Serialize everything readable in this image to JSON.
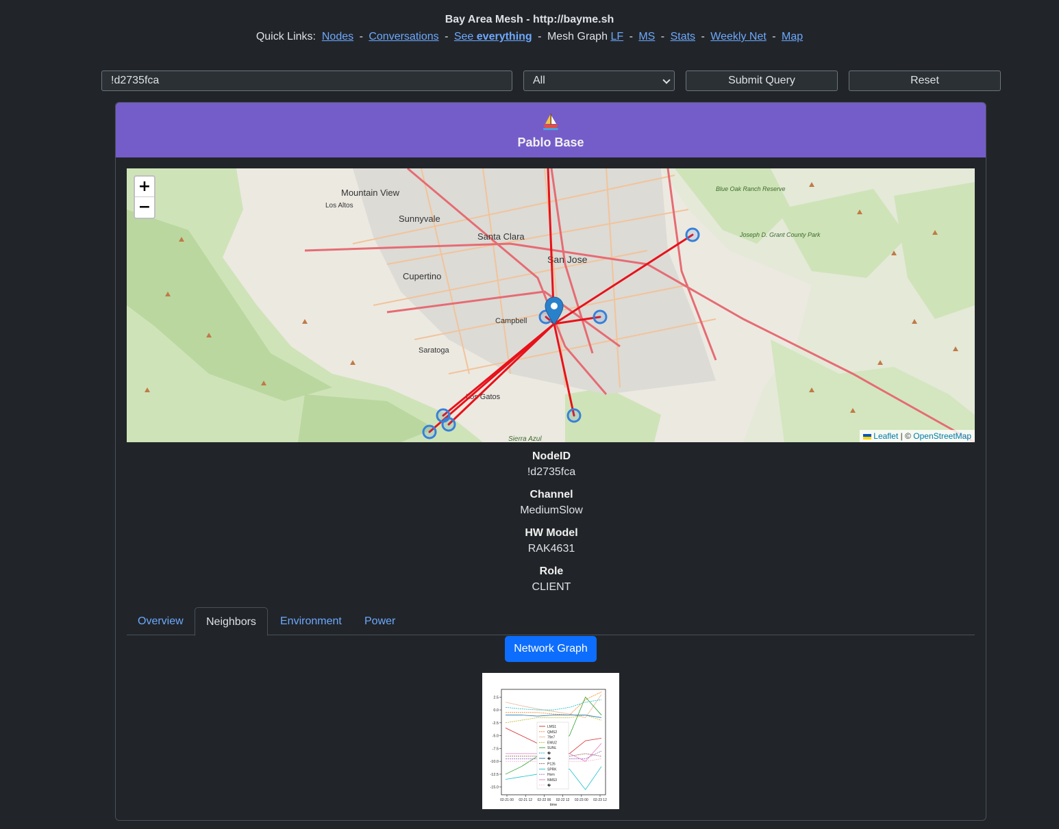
{
  "header": {
    "title": "Bay Area Mesh - http://bayme.sh",
    "quick_links_label": "Quick Links:",
    "links": {
      "nodes": "Nodes",
      "conversations": "Conversations",
      "see": "See ",
      "everything": "everything",
      "mesh_graph": "Mesh Graph",
      "lf": "LF",
      "ms": "MS",
      "stats": "Stats",
      "weekly_net": "Weekly Net",
      "map": "Map"
    },
    "sep": "-"
  },
  "query": {
    "node_value": "!d2735fca",
    "filter_selected": "All",
    "submit_label": "Submit Query",
    "reset_label": "Reset"
  },
  "node": {
    "icon": "sailboat-icon",
    "name": "Pablo Base",
    "nodeid_label": "NodeID",
    "nodeid": "!d2735fca",
    "channel_label": "Channel",
    "channel": "MediumSlow",
    "hw_label": "HW Model",
    "hw": "RAK4631",
    "role_label": "Role",
    "role": "CLIENT"
  },
  "map": {
    "zoom_in": "+",
    "zoom_out": "−",
    "attribution_leaflet": "Leaflet",
    "attribution_sep": " | © ",
    "attribution_osm": "OpenStreetMap",
    "places": [
      "Mountain View",
      "Sunnyvale",
      "Santa Clara",
      "San Jose",
      "Cupertino",
      "Campbell",
      "Saratoga",
      "Los Gatos",
      "Los Altos",
      "Sierra Azul",
      "Blue Oak Ranch Reserve",
      "Joseph D. Grant County Park"
    ],
    "link_color": "#e8111a",
    "marker_color": "#3880d8"
  },
  "tabs": {
    "overview": "Overview",
    "neighbors": "Neighbors",
    "environment": "Environment",
    "power": "Power",
    "active": "Neighbors"
  },
  "network_graph_label": "Network Graph",
  "chart_data": {
    "type": "line",
    "xlabel": "time",
    "ylabel": "",
    "ylim": [
      -16.5,
      4.0
    ],
    "yticks": [
      2.5,
      0.0,
      -2.5,
      -5.0,
      -7.5,
      -10.0,
      -12.5,
      -15.0
    ],
    "xticks": [
      "02-21 00",
      "02-21 12",
      "02-22 00",
      "02-22 12",
      "02-23 00",
      "02-23 12"
    ],
    "legend": "center",
    "series": [
      {
        "name": "LMS1",
        "color": "#d62728",
        "values": [
          -3.5,
          -5.0,
          -6.5,
          -7.5,
          -8.5,
          -6.0,
          -5.5
        ]
      },
      {
        "name": "QMS2",
        "color": "#ff7f0e",
        "values": [
          -0.5,
          -0.5,
          -0.5,
          -0.8,
          -1.0,
          2.0,
          3.5
        ]
      },
      {
        "name": "79e7",
        "color": "#e8b896",
        "values": [
          1.5,
          0.8,
          0.2,
          -0.3,
          -0.8,
          -1.5,
          3.0
        ]
      },
      {
        "name": "EMU2",
        "color": "#bcbd22",
        "values": [
          -2.5,
          -2.0,
          -1.5,
          -1.5,
          -1.5,
          -1.0,
          -2.0
        ]
      },
      {
        "name": "SUNL",
        "color": "#2ca02c",
        "values": [
          -12.5,
          -11.0,
          -9.0,
          -7.0,
          -5.0,
          2.5,
          -1.0
        ]
      },
      {
        "name": "�",
        "color": "#17becf",
        "values": [
          0.5,
          0.2,
          0.0,
          0.0,
          0.5,
          1.5,
          2.0
        ]
      },
      {
        "name": "�",
        "color": "#1f77b4",
        "values": [
          -1.0,
          -1.0,
          -1.2,
          -1.0,
          -1.0,
          -1.0,
          -1.5
        ]
      },
      {
        "name": "P126",
        "color": "#8c564b",
        "values": [
          -9.0,
          -9.0,
          -9.0,
          -9.0,
          -9.0,
          -8.5,
          -9.0
        ]
      },
      {
        "name": "SPRK",
        "color": "#17becf",
        "values": [
          -13.5,
          -13.0,
          -12.5,
          -12.0,
          -11.5,
          -15.5,
          -11.0
        ]
      },
      {
        "name": "Horn",
        "color": "#9467bd",
        "values": [
          -9.5,
          -9.5,
          -9.5,
          -9.5,
          -9.5,
          -9.5,
          -8.0
        ]
      },
      {
        "name": "NMS3",
        "color": "#e377c2",
        "values": [
          -8.5,
          -8.5,
          -8.5,
          -8.5,
          -8.5,
          -10.0,
          -6.5
        ]
      },
      {
        "name": "�",
        "color": "#f7b6d2",
        "values": [
          -10.0,
          -10.0,
          -10.0,
          -10.0,
          -10.0,
          -10.0,
          -9.5
        ]
      }
    ]
  }
}
